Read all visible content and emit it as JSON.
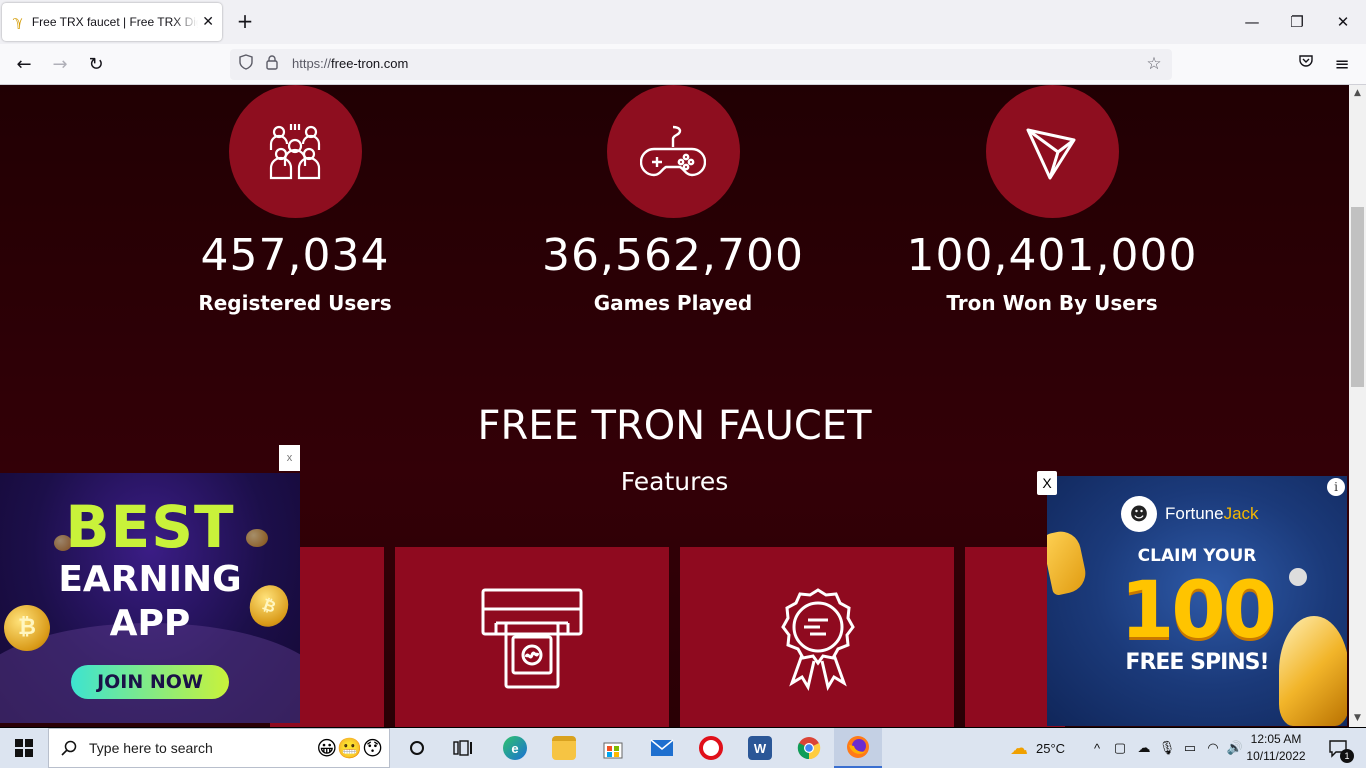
{
  "browser": {
    "tab_title": "Free TRX faucet | Free TRX Digital",
    "tab_close": "✕",
    "new_tab": "+",
    "url_prefix": "https://",
    "url_domain": "free-tron.com"
  },
  "stats": [
    {
      "value": "457,034",
      "label": "Registered Users",
      "icon": "users-icon"
    },
    {
      "value": "36,562,700",
      "label": "Games Played",
      "icon": "gamepad-icon"
    },
    {
      "value": "100,401,000",
      "label": "Tron Won By Users",
      "icon": "tron-logo-icon"
    }
  ],
  "section": {
    "title": "FREE TRON FAUCET",
    "subtitle": "Features"
  },
  "ad_left": {
    "close": "x",
    "line1": "BEST",
    "line2": "EARNING",
    "line3": "APP",
    "cta": "JOIN NOW"
  },
  "ad_right": {
    "close": "X",
    "brand_a": "Fortune",
    "brand_b": "Jack",
    "claim": "CLAIM YOUR",
    "big": "100",
    "spins": "FREE SPINS!",
    "info": "i"
  },
  "taskbar": {
    "search_placeholder": "Type here to search",
    "weather": "25°C",
    "time": "12:05 AM",
    "date": "10/11/2022",
    "notification_count": "1"
  },
  "colors": {
    "page_bg": "#2a0005",
    "accent_red": "#8e0e1f",
    "ad_green": "#c9f23a",
    "ad_gold": "#ffc400"
  }
}
